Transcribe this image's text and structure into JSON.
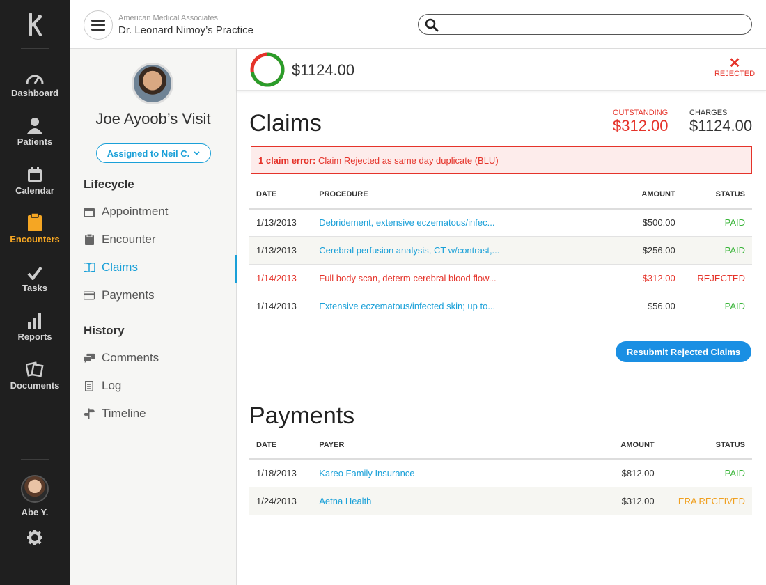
{
  "nav": {
    "items": [
      {
        "label": "Dashboard",
        "icon": "gauge-icon"
      },
      {
        "label": "Patients",
        "icon": "person-icon"
      },
      {
        "label": "Calendar",
        "icon": "calendar-icon"
      },
      {
        "label": "Encounters",
        "icon": "clipboard-icon",
        "active": true
      },
      {
        "label": "Tasks",
        "icon": "check-icon"
      },
      {
        "label": "Reports",
        "icon": "bar-chart-icon"
      },
      {
        "label": "Documents",
        "icon": "documents-icon"
      }
    ],
    "user_name": "Abe Y.",
    "active_color": "#f5a623"
  },
  "header": {
    "org": "American Medical Associates",
    "practice": "Dr. Leonard Nimoy’s Practice",
    "search_placeholder": ""
  },
  "visit": {
    "title": "Joe Ayoob’s Visit",
    "assigned": "Assigned to Neil C."
  },
  "sidebar": {
    "lifecycle_heading": "Lifecycle",
    "lifecycle": [
      {
        "label": "Appointment",
        "icon": "calendar-icon"
      },
      {
        "label": "Encounter",
        "icon": "clipboard-icon"
      },
      {
        "label": "Claims",
        "icon": "open-book-icon",
        "active": true
      },
      {
        "label": "Payments",
        "icon": "credit-card-icon"
      }
    ],
    "history_heading": "History",
    "history": [
      {
        "label": "Comments",
        "icon": "comments-icon"
      },
      {
        "label": "Log",
        "icon": "log-icon"
      },
      {
        "label": "Timeline",
        "icon": "signpost-icon"
      }
    ]
  },
  "summary": {
    "total": "$1124.00",
    "paid_fraction": 0.72,
    "status": "REJECTED"
  },
  "claims": {
    "title": "Claims",
    "outstanding_label": "OUTSTANDING",
    "outstanding": "$312.00",
    "charges_label": "CHARGES",
    "charges": "$1124.00",
    "error_prefix": "1 claim error:",
    "error_text": " Claim Rejected as same day duplicate (BLU)",
    "columns": [
      "DATE",
      "PROCEDURE",
      "AMOUNT",
      "STATUS"
    ],
    "rows": [
      {
        "date": "1/13/2013",
        "procedure": "Debridement, extensive eczematous/infec...",
        "amount": "$500.00",
        "status": "PAID"
      },
      {
        "date": "1/13/2013",
        "procedure": "Cerebral perfusion analysis, CT w/contrast,...",
        "amount": "$256.00",
        "status": "PAID"
      },
      {
        "date": "1/14/2013",
        "procedure": "Full body scan, determ cerebral blood flow...",
        "amount": "$312.00",
        "status": "REJECTED"
      },
      {
        "date": "1/14/2013",
        "procedure": "Extensive eczematous/infected skin; up to...",
        "amount": "$56.00",
        "status": "PAID"
      }
    ],
    "resubmit_label": "Resubmit Rejected Claims"
  },
  "payments": {
    "title": "Payments",
    "columns": [
      "DATE",
      "PAYER",
      "AMOUNT",
      "STATUS"
    ],
    "rows": [
      {
        "date": "1/18/2013",
        "payer": "Kareo Family Insurance",
        "amount": "$812.00",
        "status": "PAID"
      },
      {
        "date": "1/24/2013",
        "payer": "Aetna Health",
        "amount": "$312.00",
        "status": "ERA RECEIVED"
      }
    ]
  },
  "colors": {
    "accent": "#1aa0d8",
    "error": "#e5332a",
    "paid": "#3ab53a",
    "pending": "#f0a020"
  }
}
